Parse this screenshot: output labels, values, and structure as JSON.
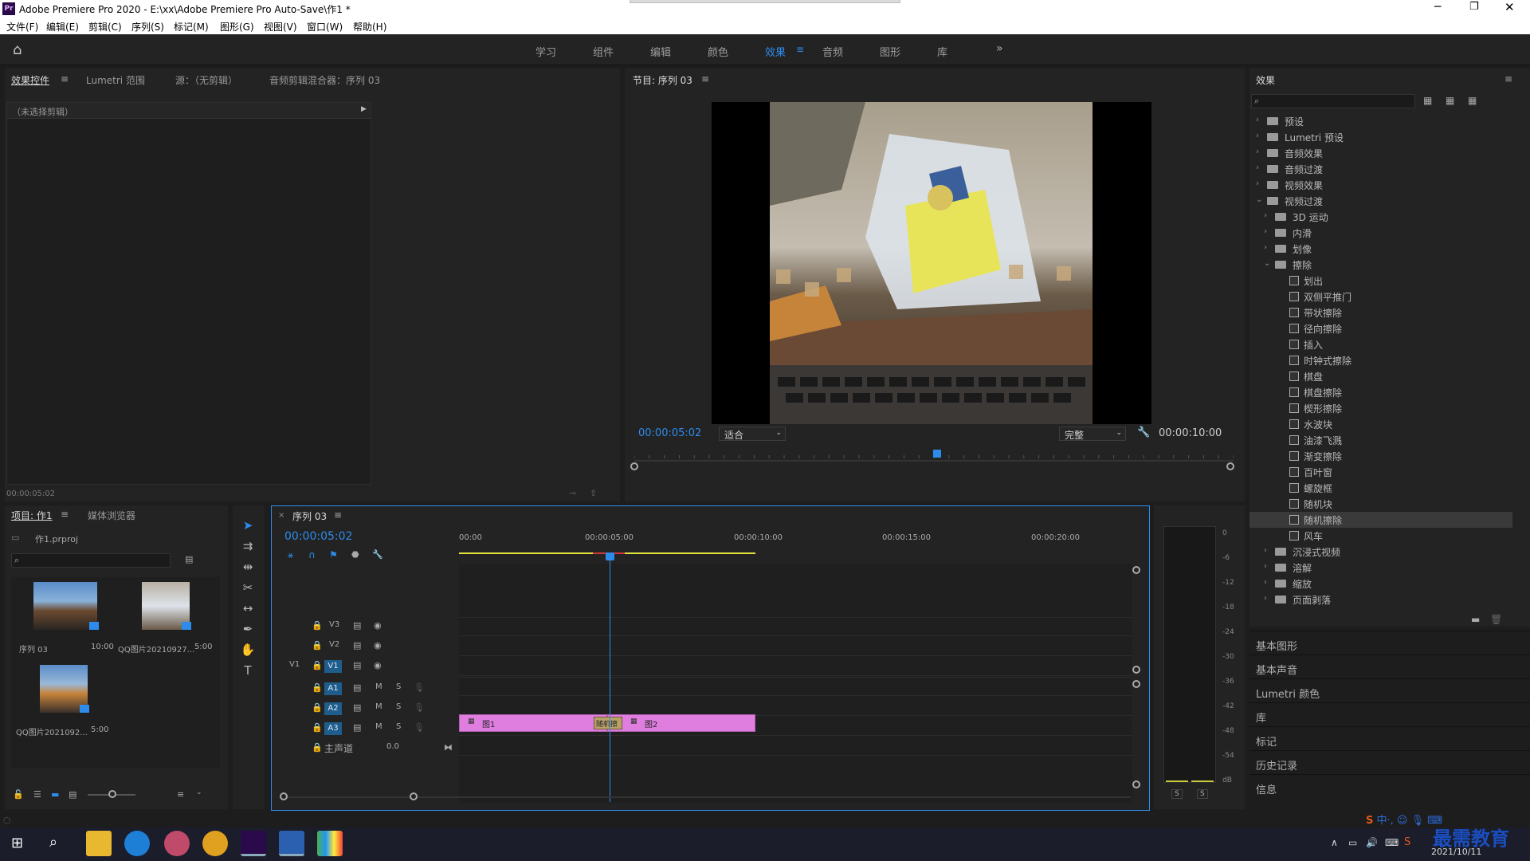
{
  "titlebar": {
    "title": "Adobe Premiere Pro 2020 - E:\\xx\\Adobe Premiere Pro Auto-Save\\作1 *"
  },
  "menu": [
    "文件(F)",
    "编辑(E)",
    "剪辑(C)",
    "序列(S)",
    "标记(M)",
    "图形(G)",
    "视图(V)",
    "窗口(W)",
    "帮助(H)"
  ],
  "workspaces": [
    "学习",
    "组件",
    "编辑",
    "颜色",
    "效果",
    "音频",
    "图形",
    "库"
  ],
  "active_workspace": "效果",
  "source_panel": {
    "tabs": [
      "效果控件",
      "Lumetri 范围",
      "源：（无剪辑）",
      "音频剪辑混合器：序列 03"
    ],
    "no_clip": "（未选择剪辑）",
    "timecode": "00:00:05:02"
  },
  "program": {
    "title": "节目: 序列 03",
    "timecode": "00:00:05:02",
    "fit": "适合",
    "quality": "完整",
    "duration": "00:00:10:00"
  },
  "effects": {
    "title": "效果",
    "tree": [
      {
        "label": "预设",
        "level": 0,
        "type": "folder",
        "open": false
      },
      {
        "label": "Lumetri 预设",
        "level": 0,
        "type": "folder",
        "open": false
      },
      {
        "label": "音频效果",
        "level": 0,
        "type": "folder",
        "open": false
      },
      {
        "label": "音频过渡",
        "level": 0,
        "type": "folder",
        "open": false
      },
      {
        "label": "视频效果",
        "level": 0,
        "type": "folder",
        "open": false
      },
      {
        "label": "视频过渡",
        "level": 0,
        "type": "folder",
        "open": true
      },
      {
        "label": "3D 运动",
        "level": 1,
        "type": "folder",
        "open": false
      },
      {
        "label": "内滑",
        "level": 1,
        "type": "folder",
        "open": false
      },
      {
        "label": "划像",
        "level": 1,
        "type": "folder",
        "open": false
      },
      {
        "label": "擦除",
        "level": 1,
        "type": "folder",
        "open": true
      },
      {
        "label": "划出",
        "level": 2,
        "type": "fx"
      },
      {
        "label": "双侧平推门",
        "level": 2,
        "type": "fx"
      },
      {
        "label": "带状擦除",
        "level": 2,
        "type": "fx"
      },
      {
        "label": "径向擦除",
        "level": 2,
        "type": "fx"
      },
      {
        "label": "插入",
        "level": 2,
        "type": "fx"
      },
      {
        "label": "时钟式擦除",
        "level": 2,
        "type": "fx"
      },
      {
        "label": "棋盘",
        "level": 2,
        "type": "fx"
      },
      {
        "label": "棋盘擦除",
        "level": 2,
        "type": "fx"
      },
      {
        "label": "楔形擦除",
        "level": 2,
        "type": "fx"
      },
      {
        "label": "水波块",
        "level": 2,
        "type": "fx"
      },
      {
        "label": "油漆飞溅",
        "level": 2,
        "type": "fx"
      },
      {
        "label": "渐变擦除",
        "level": 2,
        "type": "fx"
      },
      {
        "label": "百叶窗",
        "level": 2,
        "type": "fx"
      },
      {
        "label": "螺旋框",
        "level": 2,
        "type": "fx"
      },
      {
        "label": "随机块",
        "level": 2,
        "type": "fx"
      },
      {
        "label": "随机擦除",
        "level": 2,
        "type": "fx",
        "selected": true
      },
      {
        "label": "风车",
        "level": 2,
        "type": "fx"
      },
      {
        "label": "沉浸式视频",
        "level": 1,
        "type": "folder",
        "open": false
      },
      {
        "label": "溶解",
        "level": 1,
        "type": "folder",
        "open": false
      },
      {
        "label": "缩放",
        "level": 1,
        "type": "folder",
        "open": false
      },
      {
        "label": "页面剥落",
        "level": 1,
        "type": "folder",
        "open": false
      }
    ]
  },
  "side_panels": [
    "基本图形",
    "基本声音",
    "Lumetri 颜色",
    "库",
    "标记",
    "历史记录",
    "信息"
  ],
  "project": {
    "tabs": [
      "项目: 作1",
      "媒体浏览器"
    ],
    "file": "作1.prproj",
    "items": [
      {
        "name": "序列 03",
        "dur": "10:00"
      },
      {
        "name": "QQ图片20210927...",
        "dur": "5:00"
      },
      {
        "name": "QQ图片2021092...",
        "dur": "5:00"
      }
    ]
  },
  "timeline": {
    "tab": "序列 03",
    "timecode": "00:00:05:02",
    "ruler": [
      "00:00",
      "00:00:05:00",
      "00:00:10:00",
      "00:00:15:00",
      "00:00:20:00"
    ],
    "tracks": [
      {
        "name": "V3",
        "kind": "video"
      },
      {
        "name": "V2",
        "kind": "video"
      },
      {
        "name": "V1",
        "kind": "video",
        "src": "V1"
      },
      {
        "name": "A1",
        "kind": "audio"
      },
      {
        "name": "A2",
        "kind": "audio"
      },
      {
        "name": "A3",
        "kind": "audio"
      }
    ],
    "master": {
      "label": "主声道",
      "value": "0.0"
    },
    "clips": [
      {
        "label": "图1"
      },
      {
        "label": "图2"
      }
    ],
    "transition_label": "随机擦"
  },
  "meter": {
    "labels": [
      "0",
      "-6",
      "-12",
      "-18",
      "-24",
      "-30",
      "-36",
      "-42",
      "-48",
      "-54",
      "dB"
    ],
    "solo": [
      "S",
      "S"
    ]
  },
  "taskbar": {
    "date": "2021/10/11",
    "watermark": "最需教育"
  }
}
